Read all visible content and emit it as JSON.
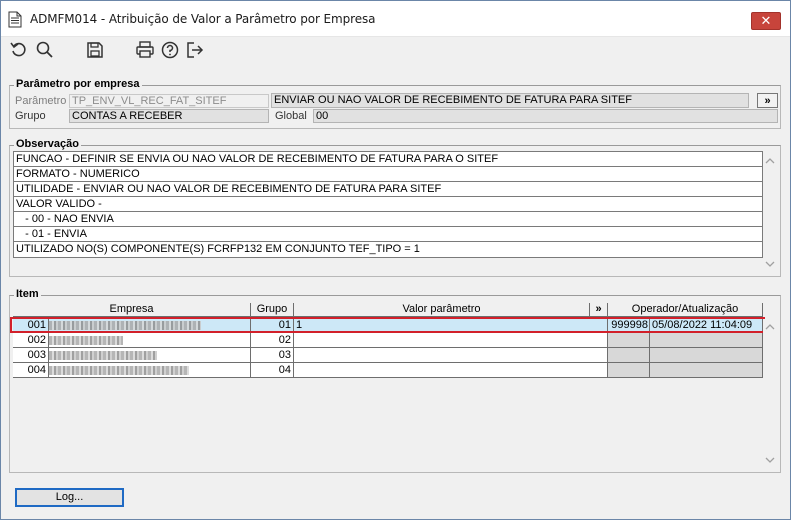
{
  "window": {
    "title": "ADMFM014 - Atribuição de Valor a Parâmetro por Empresa",
    "close_label": "✕"
  },
  "toolbar": {
    "icons": [
      "undo-icon",
      "search-icon",
      "save-icon",
      "print-icon",
      "help-icon",
      "exit-icon"
    ]
  },
  "parametro": {
    "legend": "Parâmetro por empresa",
    "parametro_label": "Parâmetro",
    "parametro_value": "TP_ENV_VL_REC_FAT_SITEF",
    "descricao_value": "ENVIAR OU NAO VALOR DE RECEBIMENTO DE FATURA PARA SITEF",
    "more_label": "»",
    "grupo_label": "Grupo",
    "grupo_value": "CONTAS A RECEBER",
    "global_label": "Global",
    "global_value": "00"
  },
  "observacao": {
    "legend": "Observação",
    "lines": [
      "FUNCAO - DEFINIR SE ENVIA OU NAO VALOR DE RECEBIMENTO DE FATURA PARA O SITEF",
      "FORMATO - NUMERICO",
      "UTILIDADE - ENVIAR OU NAO VALOR DE RECEBIMENTO DE FATURA PARA SITEF",
      "VALOR VALIDO -",
      "   - 00 - NAO ENVIA",
      "   - 01 - ENVIA",
      "UTILIZADO NO(S) COMPONENTE(S) FCRFP132 EM CONJUNTO TEF_TIPO = 1"
    ]
  },
  "item": {
    "legend": "Item",
    "columns": {
      "empresa": "Empresa",
      "grupo": "Grupo",
      "valor": "Valor parâmetro",
      "more": "»",
      "operador": "Operador/Atualização"
    },
    "rows": [
      {
        "empresa_code": "001",
        "grupo": "01",
        "valor": "1",
        "operador": "999998",
        "atualizacao": "05/08/2022 11:04:09",
        "selected": true
      },
      {
        "empresa_code": "002",
        "grupo": "02",
        "valor": "",
        "operador": "",
        "atualizacao": "",
        "selected": false
      },
      {
        "empresa_code": "003",
        "grupo": "03",
        "valor": "",
        "operador": "",
        "atualizacao": "",
        "selected": false
      },
      {
        "empresa_code": "004",
        "grupo": "04",
        "valor": "",
        "operador": "",
        "atualizacao": "",
        "selected": false
      }
    ]
  },
  "footer": {
    "log_label": "Log..."
  }
}
